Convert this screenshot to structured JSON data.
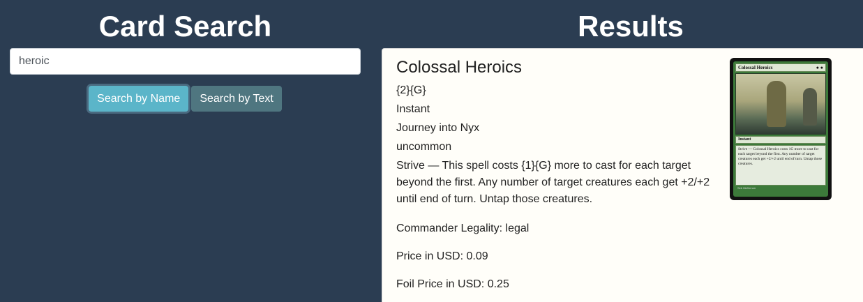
{
  "search": {
    "title": "Card Search",
    "query": "heroic",
    "by_name_label": "Search by Name",
    "by_text_label": "Search by Text"
  },
  "results": {
    "title": "Results",
    "card": {
      "name": "Colossal Heroics",
      "mana_cost": "{2}{G}",
      "type": "Instant",
      "set": "Journey into Nyx",
      "rarity": "uncommon",
      "oracle_text": "Strive — This spell costs {1}{G} more to cast for each target beyond the first. Any number of target creatures each get +2/+2 until end of turn. Untap those creatures.",
      "commander_legality": "Commander Legality: legal",
      "price_usd": "Price in USD: 0.09",
      "foil_price_usd": "Foil Price in USD: 0.25",
      "image": {
        "name": "Colossal Heroics",
        "type_line": "Instant",
        "rules_text": "Strive — Colossal Heroics costs 1G more to cast for each target beyond the first. Any number of target creatures each get +2/+2 until end of turn. Untap those creatures.",
        "artist": "Seb McKinnon"
      }
    }
  },
  "colors": {
    "background": "#2b3d52",
    "primary_button": "#5bb5c9",
    "secondary_button": "#4f7680",
    "results_bg": "#fffef9"
  }
}
